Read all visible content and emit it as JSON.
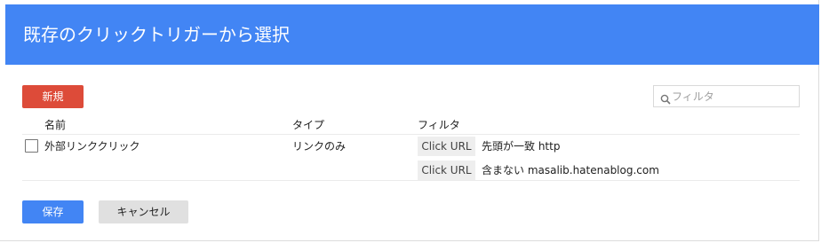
{
  "dialog": {
    "title": "既存のクリックトリガーから選択"
  },
  "toolbar": {
    "new_label": "新規",
    "search_placeholder": "フィルタ"
  },
  "table": {
    "headers": {
      "name": "名前",
      "type": "タイプ",
      "filter": "フィルタ"
    },
    "rows": [
      {
        "name": "外部リンククリック",
        "type": "リンクのみ",
        "selected": false,
        "filters": [
          {
            "variable": "Click URL",
            "condition": "先頭が一致 http"
          },
          {
            "variable": "Click URL",
            "condition": "含まない masalib.hatenablog.com"
          }
        ]
      }
    ]
  },
  "footer": {
    "save_label": "保存",
    "cancel_label": "キャンセル"
  },
  "colors": {
    "header": "#4285f4",
    "new_button": "#dd4b39",
    "save_button": "#4285f4",
    "cancel_button": "#e0e0e0"
  },
  "icons": {
    "search": "search-icon"
  }
}
